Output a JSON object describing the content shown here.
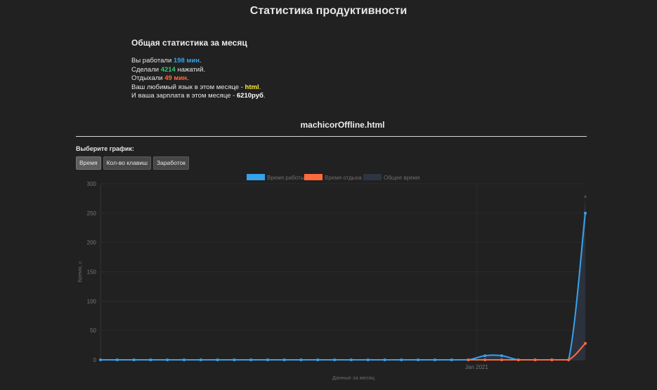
{
  "header": {
    "title": "Статистика продуктивности"
  },
  "summary": {
    "title": "Общая статистика за месяц",
    "worked_prefix": "Вы работали ",
    "worked_value": "198 мин",
    "worked_suffix": ".",
    "keys_prefix": "Сделали ",
    "keys_value": "4214",
    "keys_suffix": " нажатий.",
    "rest_prefix": "Отдыхали ",
    "rest_value": "49 мин",
    "rest_suffix": ".",
    "lang_prefix": "Ваш любимый язык в этом месяце - ",
    "lang_value": "html",
    "lang_suffix": ".",
    "salary_prefix": "И ваша зарплата в этом месяце - ",
    "salary_value": "6210руб",
    "salary_suffix": "."
  },
  "file": {
    "title": "machicorOffline.html"
  },
  "chart_select": {
    "label": "Выберите график:",
    "buttons": [
      "Время",
      "Кол-во клавиш",
      "Заработок"
    ],
    "active_index": 0
  },
  "colors": {
    "work": "#36a2eb",
    "rest": "#ff6a3d",
    "total": "#2e3542",
    "keys": "#2ecc71",
    "language": "#ffeb3b"
  },
  "chart_data": {
    "type": "line",
    "xlabel": "Данные за месяц",
    "ylabel": "Время, с",
    "ylim": [
      0,
      300
    ],
    "yticks": [
      0,
      50,
      100,
      150,
      200,
      250,
      300
    ],
    "x_tick_label": "Jan 2021",
    "x_tick_index": 22.5,
    "grid": true,
    "legend": "top",
    "series": [
      {
        "name": "Время работы",
        "color": "#36a2eb",
        "values": [
          0,
          0,
          0,
          0,
          0,
          0,
          0,
          0,
          0,
          0,
          0,
          0,
          0,
          0,
          0,
          0,
          0,
          0,
          0,
          0,
          0,
          0,
          0,
          7,
          7,
          0,
          0,
          0,
          0,
          250
        ]
      },
      {
        "name": "Время отдыха",
        "color": "#ff6a3d",
        "values": [
          null,
          null,
          null,
          null,
          null,
          null,
          null,
          null,
          null,
          null,
          null,
          null,
          null,
          null,
          null,
          null,
          null,
          null,
          null,
          null,
          null,
          null,
          0,
          0,
          0,
          0,
          0,
          0,
          0,
          28
        ]
      },
      {
        "name": "Общее время",
        "color": "#2e3542",
        "values": [
          0,
          0,
          0,
          0,
          0,
          0,
          0,
          0,
          0,
          0,
          0,
          0,
          0,
          0,
          0,
          0,
          0,
          0,
          0,
          0,
          0,
          0,
          0,
          7,
          7,
          0,
          0,
          0,
          0,
          278
        ]
      }
    ]
  }
}
